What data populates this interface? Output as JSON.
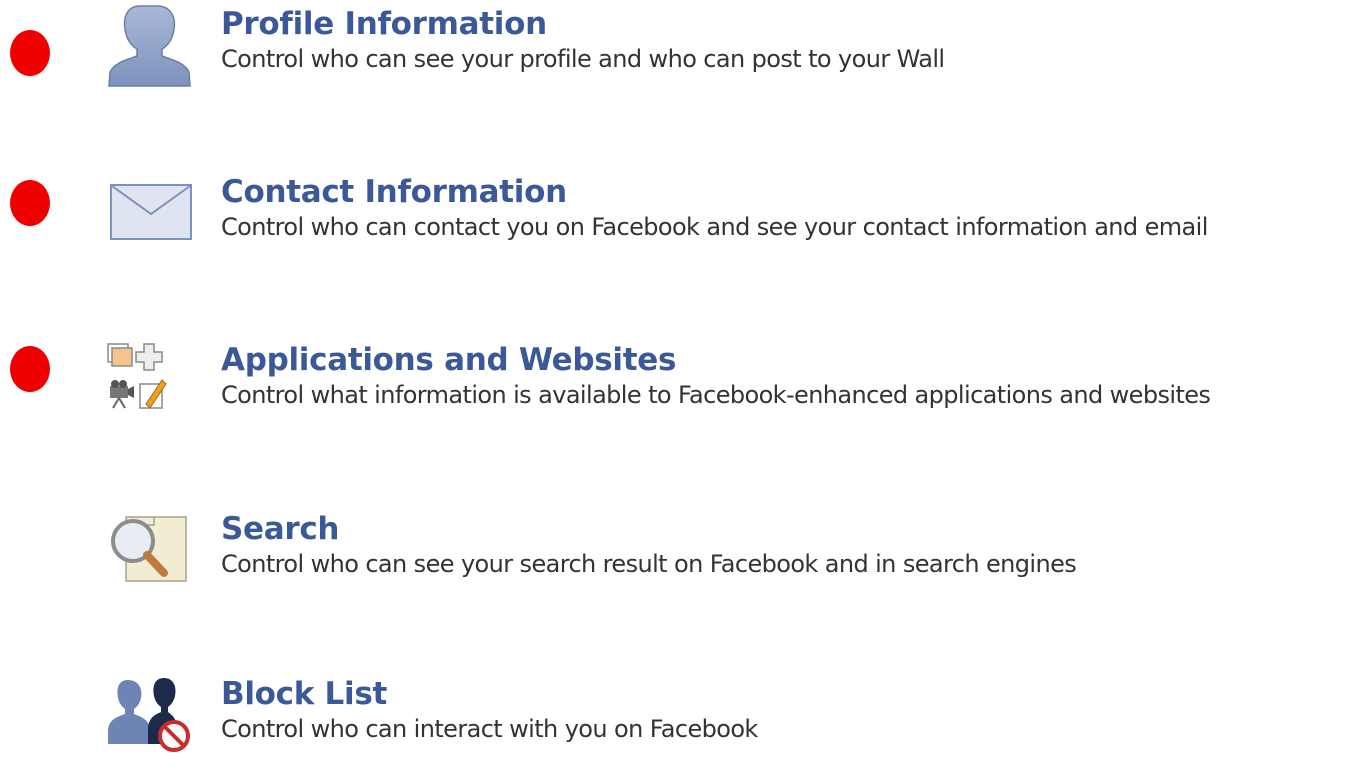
{
  "colors": {
    "link_blue": "#3b5998",
    "text": "#333333",
    "marker_red": "#ee0000"
  },
  "settings": [
    {
      "icon": "profile-silhouette-icon",
      "title": "Profile Information",
      "description": "Control who can see your profile and who can post to your Wall",
      "marked": true
    },
    {
      "icon": "envelope-icon",
      "title": "Contact Information",
      "description": "Control who can contact you on Facebook and see your contact information and email",
      "marked": true
    },
    {
      "icon": "applications-icon",
      "title": "Applications and Websites",
      "description": "Control what information is available to Facebook-enhanced applications and websites",
      "marked": true
    },
    {
      "icon": "search-magnifier-icon",
      "title": "Search",
      "description": "Control who can see your search result on Facebook and in search engines",
      "marked": false
    },
    {
      "icon": "block-list-icon",
      "title": "Block List",
      "description": "Control who can interact with you on Facebook",
      "marked": false
    }
  ]
}
